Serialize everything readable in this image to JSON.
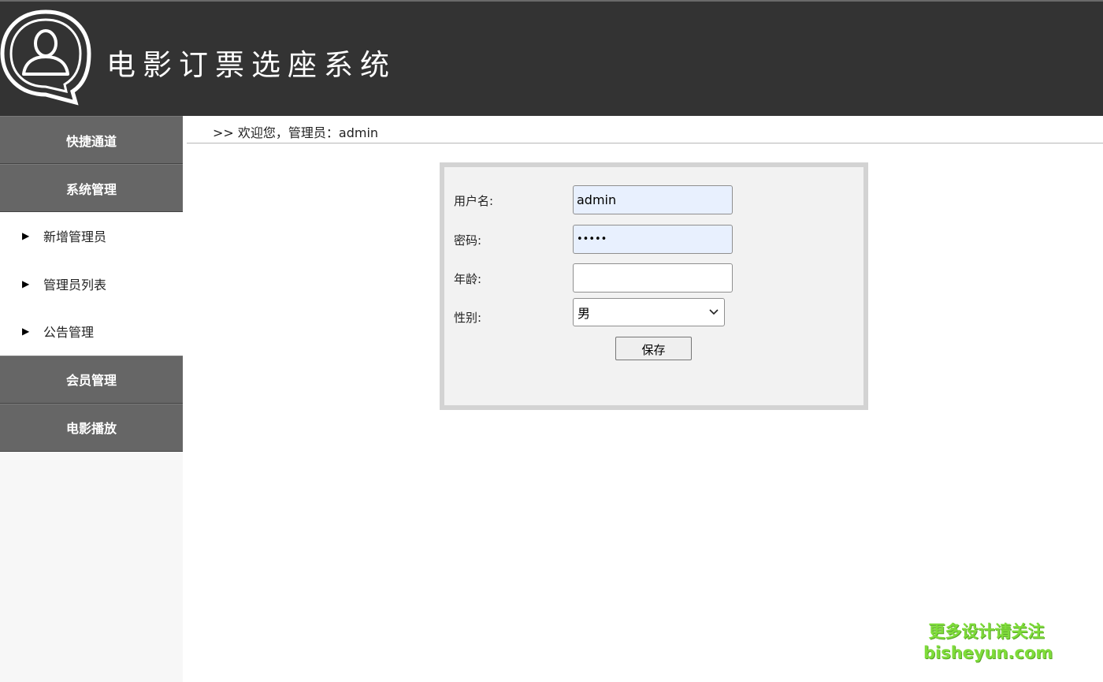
{
  "header": {
    "title": "电影订票选座系统",
    "logo_icon": "user-chat-bubble-icon"
  },
  "sidebar": {
    "sections": [
      {
        "label": "快捷通道"
      },
      {
        "label": "系统管理",
        "items": [
          "新增管理员",
          "管理员列表",
          "公告管理"
        ]
      },
      {
        "label": "会员管理"
      },
      {
        "label": "电影播放"
      }
    ]
  },
  "breadcrumb": {
    "text": ">> 欢迎您，管理员：admin"
  },
  "form": {
    "username_label": "用户名:",
    "username_value": "admin",
    "password_label": "密码:",
    "password_value": "•••••",
    "age_label": "年龄:",
    "age_value": "",
    "gender_label": "性别:",
    "gender_value": "男",
    "save_label": "保存"
  },
  "watermark": {
    "line1": "更多设计请关注",
    "line2": "bisheyun.com"
  },
  "colors": {
    "header_bg": "#333333",
    "nav_head_bg": "#666666",
    "autofill_bg": "#e8f0fe",
    "watermark": "#7fdc3a"
  }
}
